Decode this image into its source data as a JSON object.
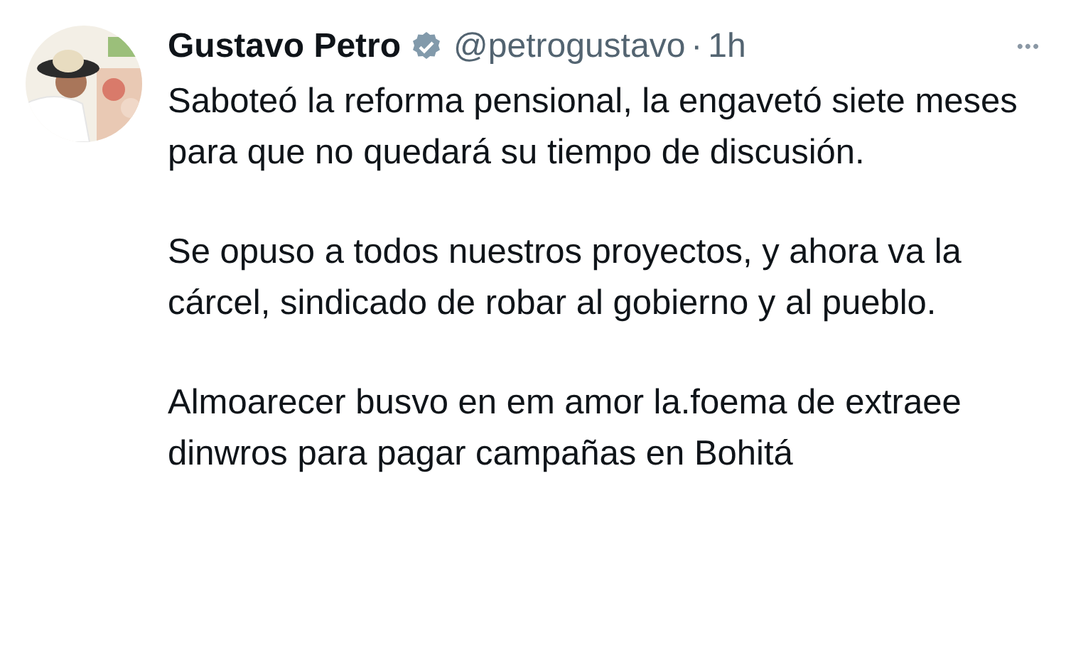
{
  "post": {
    "author": "Gustavo Petro",
    "verified": true,
    "handle": "@petrogustavo",
    "separator": "·",
    "time": "1h",
    "more": "•••",
    "paragraphs": [
      "Saboteó la reforma pensional, la engavetó siete meses para que no quedará su tiempo de discusión.",
      "Se opuso a todos nuestros proyectos, y ahora va la cárcel, sindicado de robar al gobierno y al pueblo.",
      "Almoarecer busvo en em amor la.foema de extraee dinwros para pagar campañas en Bohitá"
    ]
  }
}
